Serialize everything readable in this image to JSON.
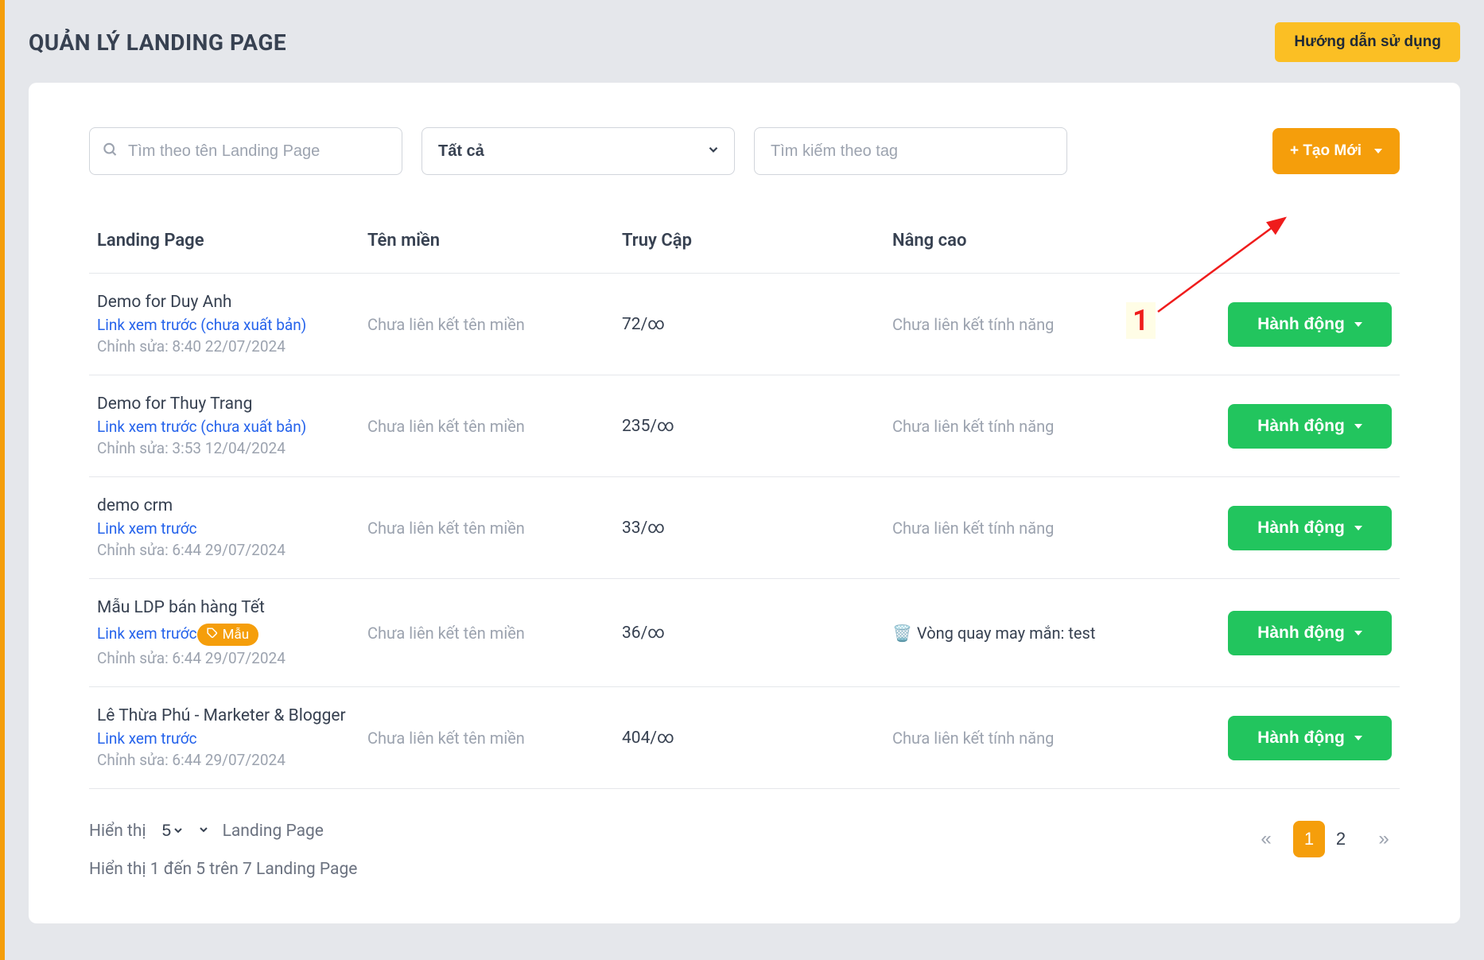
{
  "header": {
    "title": "QUẢN LÝ LANDING PAGE",
    "guide_label": "Hướng dẫn sử dụng"
  },
  "filters": {
    "search_placeholder": "Tìm theo tên Landing Page",
    "select_value": "Tất cả",
    "tag_placeholder": "Tìm kiếm theo tag",
    "create_label": "+ Tạo Mới"
  },
  "annotation": {
    "number": "1"
  },
  "table": {
    "columns": {
      "landing_page": "Landing Page",
      "domain": "Tên miền",
      "traffic": "Truy Cập",
      "advanced": "Nâng cao"
    },
    "action_label": "Hành động",
    "edit_prefix": "Chỉnh sửa: ",
    "rows": [
      {
        "name": "Demo for Duy Anh",
        "link_text": "Link xem trước (chưa xuất bản)",
        "edited": "8:40 22/07/2024",
        "domain": "Chưa liên kết tên miền",
        "traffic": "72/∞",
        "advanced": "Chưa liên kết tính năng",
        "badge": null,
        "adv_icon": null
      },
      {
        "name": "Demo for Thuy Trang",
        "link_text": "Link xem trước (chưa xuất bản)",
        "edited": "3:53 12/04/2024",
        "domain": "Chưa liên kết tên miền",
        "traffic": "235/∞",
        "advanced": "Chưa liên kết tính năng",
        "badge": null,
        "adv_icon": null
      },
      {
        "name": "demo crm",
        "link_text": "Link xem trước",
        "edited": "6:44 29/07/2024",
        "domain": "Chưa liên kết tên miền",
        "traffic": "33/∞",
        "advanced": "Chưa liên kết tính năng",
        "badge": null,
        "adv_icon": null
      },
      {
        "name": "Mẫu LDP bán hàng Tết",
        "link_text": "Link xem trước",
        "edited": "6:44 29/07/2024",
        "domain": "Chưa liên kết tên miền",
        "traffic": "36/∞",
        "advanced": "Vòng quay may mắn: test",
        "badge": "Mẫu",
        "adv_icon": "trash"
      },
      {
        "name": "Lê Thừa Phú - Marketer & Blogger",
        "link_text": "Link xem trước",
        "edited": "6:44 29/07/2024",
        "domain": "Chưa liên kết tên miền",
        "traffic": "404/∞",
        "advanced": "Chưa liên kết tính năng",
        "badge": null,
        "adv_icon": null
      }
    ]
  },
  "footer": {
    "show_label": "Hiển thị",
    "per_page_value": "5",
    "per_page_suffix": "Landing Page",
    "summary": "Hiển thị 1 đến 5 trên 7 Landing Page",
    "pages": [
      "1",
      "2"
    ],
    "current_page": "1"
  }
}
